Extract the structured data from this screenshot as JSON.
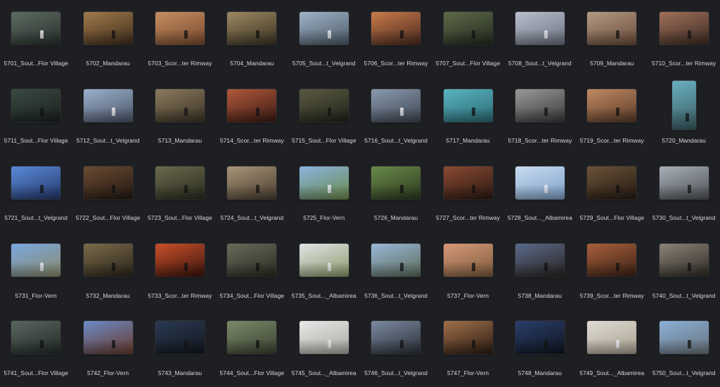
{
  "files": [
    {
      "label": "5701_Sout...Flor Village",
      "c1": "#5d6b62",
      "c2": "#27302c"
    },
    {
      "label": "5702_Mandarau",
      "c1": "#a07a4a",
      "c2": "#3e2c1c"
    },
    {
      "label": "5703_Scor...ter Rimway",
      "c1": "#c48e62",
      "c2": "#7a4a2e"
    },
    {
      "label": "5704_Mandarau",
      "c1": "#9c8862",
      "c2": "#3a3222"
    },
    {
      "label": "5705_Sout...t_Velgrand",
      "c1": "#9fb2c8",
      "c2": "#4c5a66"
    },
    {
      "label": "5706_Scor...ter Rimway",
      "c1": "#c87a4a",
      "c2": "#4a2a1e"
    },
    {
      "label": "5707_Sout...Flor Village",
      "c1": "#5e6a4a",
      "c2": "#222a1e"
    },
    {
      "label": "5708_Sout...t_Velgrand",
      "c1": "#b8c0cc",
      "c2": "#6a7080"
    },
    {
      "label": "5709_Mandarau",
      "c1": "#b39a82",
      "c2": "#6a4a3a"
    },
    {
      "label": "5710_Scor...ter Rimway",
      "c1": "#a0705a",
      "c2": "#3a2a22"
    },
    {
      "label": "5711_Sout...Flor Village",
      "c1": "#3a4a42",
      "c2": "#1a201e"
    },
    {
      "label": "5712_Sout...t_Velgrand",
      "c1": "#9ab0cc",
      "c2": "#4a5466"
    },
    {
      "label": "5713_Mandarau",
      "c1": "#8a7a5e",
      "c2": "#3a3224"
    },
    {
      "label": "5714_Scor...ter Rimway",
      "c1": "#b0583a",
      "c2": "#3a1a14"
    },
    {
      "label": "5715_Sout...Flor Village",
      "c1": "#5a5a42",
      "c2": "#22221a"
    },
    {
      "label": "5716_Sout...t_Velgrand",
      "c1": "#8a9aae",
      "c2": "#3e4652"
    },
    {
      "label": "5717_Mandarau",
      "c1": "#5ab4c0",
      "c2": "#2a6a74"
    },
    {
      "label": "5718_Scor...ter Rimway",
      "c1": "#9a9898",
      "c2": "#3a3838"
    },
    {
      "label": "5719_Scor...ter Rimway",
      "c1": "#c08a62",
      "c2": "#5a3a28"
    },
    {
      "label": "5720_Mandarau",
      "c1": "#6ab0c0",
      "c2": "#3a5a60"
    },
    {
      "label": "5721_Sout...t_Velgrand",
      "c1": "#5a8ad8",
      "c2": "#24386a"
    },
    {
      "label": "5722_Sout...Flor Village",
      "c1": "#6a4a32",
      "c2": "#221812"
    },
    {
      "label": "5723_Sout...Flor Village",
      "c1": "#6a6a4e",
      "c2": "#2a2a1e"
    },
    {
      "label": "5724_Sout...t_Velgrand",
      "c1": "#a89478",
      "c2": "#4a3e30"
    },
    {
      "label": "5725_Flor-Vern",
      "c1": "#8ab4e0",
      "c2": "#6a8a4a"
    },
    {
      "label": "5726_Mandarau",
      "c1": "#6a8a4a",
      "c2": "#2a3a1e"
    },
    {
      "label": "5727_Scor...ter Rimway",
      "c1": "#8a4a32",
      "c2": "#2a1812"
    },
    {
      "label": "5728_Sout..._Albamirea",
      "c1": "#c8dcf0",
      "c2": "#7ea0c8"
    },
    {
      "label": "5729_Sout...Flor Village",
      "c1": "#6a5238",
      "c2": "#241a12"
    },
    {
      "label": "5730_Sout...t_Velgrand",
      "c1": "#a8b0b8",
      "c2": "#4e5056"
    },
    {
      "label": "5731_Flor-Vern",
      "c1": "#7aa8e0",
      "c2": "#8a8a6a"
    },
    {
      "label": "5732_Mandarau",
      "c1": "#7a6a4a",
      "c2": "#2a241a"
    },
    {
      "label": "5733_Scor...ter Rimway",
      "c1": "#c8502a",
      "c2": "#3a140c"
    },
    {
      "label": "5734_Sout...Flor Village",
      "c1": "#6a6a5a",
      "c2": "#2a2a22"
    },
    {
      "label": "5735_Sout..._Albamirea",
      "c1": "#e0e4e6",
      "c2": "#8a9a6a"
    },
    {
      "label": "5736_Sout...t_Velgrand",
      "c1": "#9ab8d8",
      "c2": "#5a6a5a"
    },
    {
      "label": "5737_Flor-Vern",
      "c1": "#d89a7a",
      "c2": "#7a5a3a"
    },
    {
      "label": "5738_Mandarau",
      "c1": "#5a6a8a",
      "c2": "#2a2420"
    },
    {
      "label": "5739_Scor...ter Rimway",
      "c1": "#a8603a",
      "c2": "#3a2016"
    },
    {
      "label": "5740_Sout...t_Velgrand",
      "c1": "#8a8276",
      "c2": "#2e2a26"
    },
    {
      "label": "5741_Sout...Flor Village",
      "c1": "#5a6660",
      "c2": "#222a26"
    },
    {
      "label": "5742_Flor-Vern",
      "c1": "#6a8ac8",
      "c2": "#6a3a2a"
    },
    {
      "label": "5743_Mandarau",
      "c1": "#2a3a52",
      "c2": "#12161e"
    },
    {
      "label": "5744_Sout...Flor Village",
      "c1": "#7a8a6a",
      "c2": "#3a4030"
    },
    {
      "label": "5745_Sout..._Albamirea",
      "c1": "#e8e8e6",
      "c2": "#a8a8a4"
    },
    {
      "label": "5746_Sout...t_Velgrand",
      "c1": "#7a8aa0",
      "c2": "#2a2e36"
    },
    {
      "label": "5747_Flor-Vern",
      "c1": "#a0704a",
      "c2": "#2a1a12"
    },
    {
      "label": "5748_Mandarau",
      "c1": "#2a3e6a",
      "c2": "#0e141e"
    },
    {
      "label": "5749_Sout..._Albamirea",
      "c1": "#e0dcd4",
      "c2": "#a8a090"
    },
    {
      "label": "5750_Sout...t_Velgrand",
      "c1": "#8ab0d8",
      "c2": "#6a727a"
    }
  ]
}
